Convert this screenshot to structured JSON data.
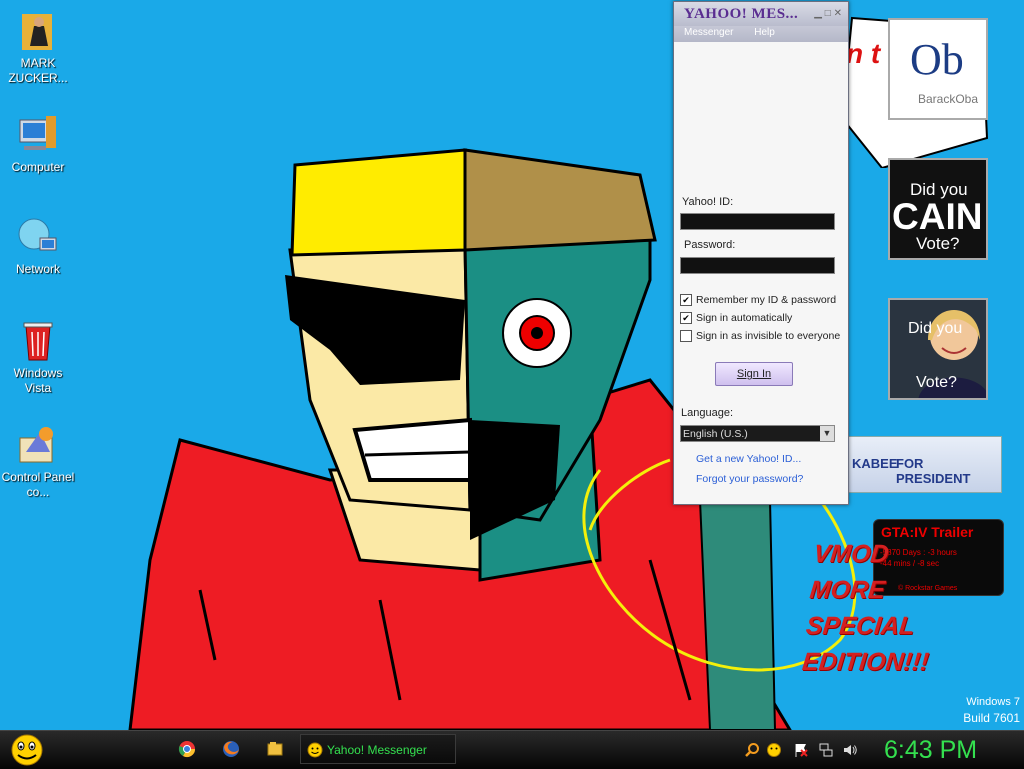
{
  "desktop_icons": [
    {
      "label": "MARK ZUCKER...",
      "icon": "folder-person-icon"
    },
    {
      "label": "Computer",
      "icon": "computer-icon"
    },
    {
      "label": "Network",
      "icon": "network-icon"
    },
    {
      "label": "Windows Vista",
      "icon": "recycle-bin-icon"
    },
    {
      "label": "Control Panel co...",
      "icon": "control-panel-icon"
    }
  ],
  "messenger": {
    "title": "YAHOO! MES...",
    "menu": [
      "Messenger",
      "Help"
    ],
    "yahoo_id_label": "Yahoo! ID:",
    "password_label": "Password:",
    "remember_label": "Remember my ID & password",
    "remember_checked": true,
    "auto_label": "Sign in automatically",
    "auto_checked": true,
    "invisible_label": "Sign in as invisible to everyone",
    "invisible_checked": false,
    "signin_label": "Sign In",
    "language_label": "Language:",
    "language_value": "English (U.S.)",
    "new_id_link": "Get a new Yahoo! ID...",
    "forgot_link": "Forgot your password?"
  },
  "gadgets": {
    "obama_text": "Ob",
    "obama_sub": "BarackOba",
    "cain_line1": "Did you",
    "cain_big": "CAIN",
    "cain_line3": "Vote?",
    "hillary_line1": "Did you",
    "hillary_line2": "Vote?",
    "huckabee_name": "KABEE",
    "huckabee_tag": "FOR PRESIDENT",
    "speech_text": "n t",
    "gta_title": "GTA:IV Trailer",
    "gta_countdown1": "-5870 Days : -3 hours",
    "gta_countdown2": "-44 mins / -8 sec",
    "gta_credit": "© Rockstar Games",
    "vmod_lines": [
      "VMOD",
      "MORE",
      "SPECIAL",
      "EDITION!!!"
    ]
  },
  "watermark": {
    "line1": "Windows 7",
    "line2": "Build 7601"
  },
  "taskbar": {
    "task_label": "Yahoo! Messenger",
    "clock": "6:43 PM"
  },
  "colors": {
    "desktop": "#1aa9e8",
    "clock": "#34e04f",
    "vmod": "#d42020"
  }
}
